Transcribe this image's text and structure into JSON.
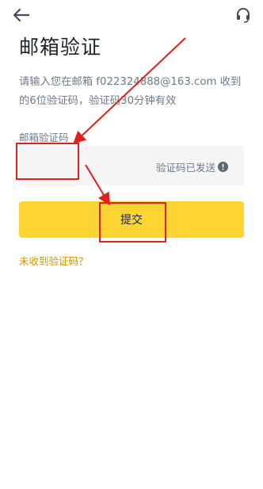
{
  "header": {
    "back_icon": "arrow-left-icon",
    "support_icon": "headset-icon"
  },
  "page": {
    "title": "邮箱验证",
    "description": "请输入您在邮箱 f022324888@163.com 收到的6位验证码，验证码30分钟有效"
  },
  "form": {
    "code_label": "邮箱验证码",
    "code_value": "",
    "sent_status": "验证码已发送",
    "info_icon": "info-circle-icon",
    "submit_label": "提交",
    "resend_link": "未收到验证码？"
  },
  "colors": {
    "accent": "#fcd535",
    "link": "#c99400",
    "annotation": "#e0201c"
  }
}
